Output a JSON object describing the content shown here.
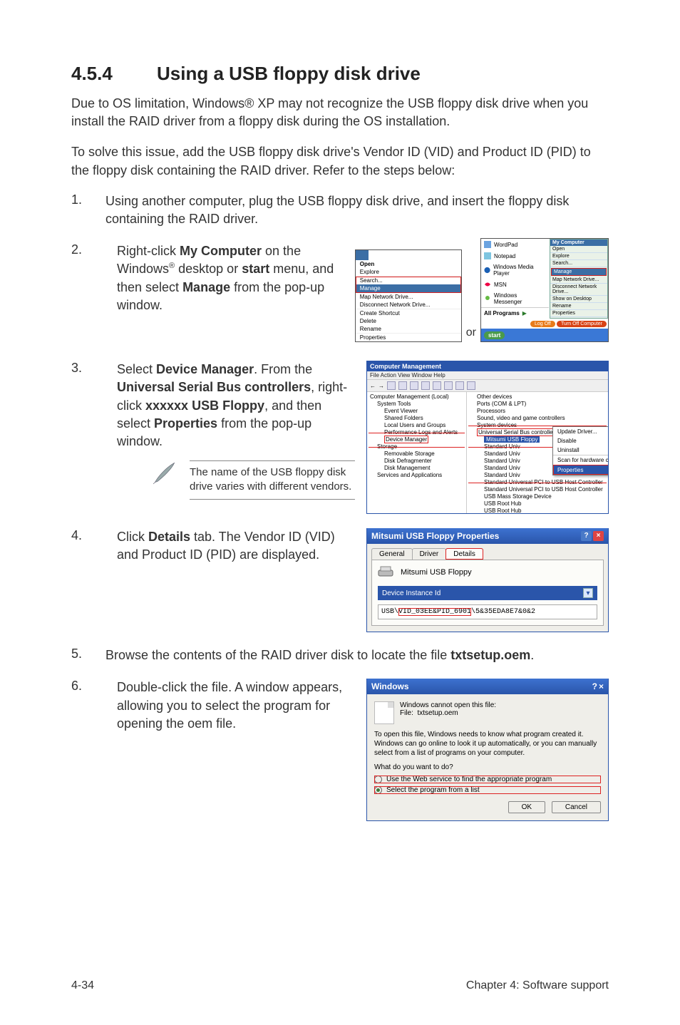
{
  "heading": {
    "number": "4.5.4",
    "title": "Using a USB floppy disk drive"
  },
  "intro1": "Due to OS limitation, Windows® XP may not recognize the USB floppy disk drive when you install the RAID driver from a floppy disk during the OS installation.",
  "intro2": "To solve this issue, add the USB floppy disk drive's Vendor ID (VID) and Product ID (PID) to the floppy disk containing the RAID driver. Refer to the steps below:",
  "steps": {
    "s1": {
      "n": "1.",
      "t": "Using another computer, plug the USB floppy disk drive, and insert the floppy disk containing the RAID driver."
    },
    "s2": {
      "n": "2.",
      "t_pre": "Right-click ",
      "b1": "My Computer",
      "t_mid1": " on the Windows",
      "reg": "®",
      "t_mid2": " desktop or ",
      "b2": "start",
      "t_mid3": " menu, and then select ",
      "b3": "Manage",
      "t_end": " from the pop-up window."
    },
    "s3": {
      "n": "3.",
      "t_pre": "Select ",
      "b1": "Device Manager",
      "t_mid1": ". From the ",
      "b2": "Universal Serial Bus controllers",
      "t_mid2": ", right-click ",
      "b3": "xxxxxx USB Floppy",
      "t_mid3": ", and then select ",
      "b4": "Properties",
      "t_end": " from the pop-up window."
    },
    "s4": {
      "n": "4.",
      "t_pre": "Click ",
      "b1": "Details",
      "t_end": " tab. The Vendor ID (VID) and Product ID (PID) are displayed."
    },
    "s5": {
      "n": "5.",
      "t_pre": "Browse the contents of the RAID driver disk to locate the file ",
      "b1": "txtsetup.oem",
      "t_end": "."
    },
    "s6": {
      "n": "6.",
      "t": "Double-click the file. A window appears, allowing you to select the program for opening the oem file."
    }
  },
  "note": "The name of the USB floppy disk drive varies with different vendors.",
  "or_label": "or",
  "shot1a": {
    "open": "Open",
    "explore": "Explore",
    "search": "Search...",
    "manage": "Manage",
    "map": "Map Network Drive...",
    "disc": "Disconnect Network Drive...",
    "shortcut": "Create Shortcut",
    "delete": "Delete",
    "rename": "Rename",
    "props": "Properties"
  },
  "shot1b": {
    "apps": {
      "wordpad": "WordPad",
      "notepad": "Notepad",
      "wmp": "Windows Media Player",
      "msn": "MSN",
      "wmsg": "Windows Messenger",
      "allprog": "All Programs"
    },
    "right": {
      "title": "My Computer",
      "open": "Open",
      "explore": "Explore",
      "search": "Search...",
      "manage": "Manage",
      "map": "Map Network Drive...",
      "disc": "Disconnect Network Drive...",
      "show": "Show on Desktop",
      "rename": "Rename",
      "props": "Properties"
    },
    "logoff": "Log Off",
    "turnoff": "Turn Off Computer",
    "start": "start"
  },
  "shot2": {
    "title": "Computer Management",
    "menu": "File   Action   View   Window   Help",
    "treeL": {
      "root": "Computer Management (Local)",
      "systools": "System Tools",
      "ev": "Event Viewer",
      "sf": "Shared Folders",
      "lug": "Local Users and Groups",
      "pla": "Performance Logs and Alerts",
      "dm": "Device Manager",
      "storage": "Storage",
      "rs": "Removable Storage",
      "dd": "Disk Defragmenter",
      "dmg": "Disk Management",
      "sa": "Services and Applications"
    },
    "treeR": {
      "other": "Other devices",
      "ports": "Ports (COM & LPT)",
      "proc": "Processors",
      "svg": "Sound, video and game controllers",
      "sysd": "System devices",
      "usb": "Universal Serial Bus controllers",
      "floppy": "Mitsumi USB Floppy",
      "std": "Standard Univ",
      "std2": "Standard Univ",
      "std3": "Standard Univ",
      "std4": "Standard Univ",
      "std5": "Standard Univ",
      "suhc": "Standard Universal PCI to USB Host Controller",
      "suhc2": "Standard Universal PCI to USB Host Controller",
      "mass": "USB Mass Storage Device",
      "root1": "USB Root Hub",
      "root2": "USB Root Hub"
    },
    "ctx": {
      "update": "Update Driver...",
      "disable": "Disable",
      "uninstall": "Uninstall",
      "scan": "Scan for hardware changes",
      "props": "Properties"
    }
  },
  "shot3": {
    "title": "Mitsumi USB Floppy Properties",
    "tabs": {
      "general": "General",
      "driver": "Driver",
      "details": "Details"
    },
    "device": "Mitsumi USB Floppy",
    "combo": "Device Instance Id",
    "id_pre": "USB\\",
    "id_vidpid": "VID_03EE&PID_6901",
    "id_post": "\\5&35EDA8E7&0&2"
  },
  "shot4": {
    "title": "Windows",
    "cannot": "Windows cannot open this file:",
    "file_lbl": "File:",
    "file_name": "txtsetup.oem",
    "desc": "To open this file, Windows needs to know what program created it.  Windows can go online to look it up automatically, or you can manually select from a list of programs on your computer.",
    "q": "What do you want to do?",
    "r1": "Use the Web service to find the appropriate program",
    "r2": "Select the program from a list",
    "ok": "OK",
    "cancel": "Cancel"
  },
  "footer": {
    "left": "4-34",
    "right": "Chapter 4: Software support"
  }
}
